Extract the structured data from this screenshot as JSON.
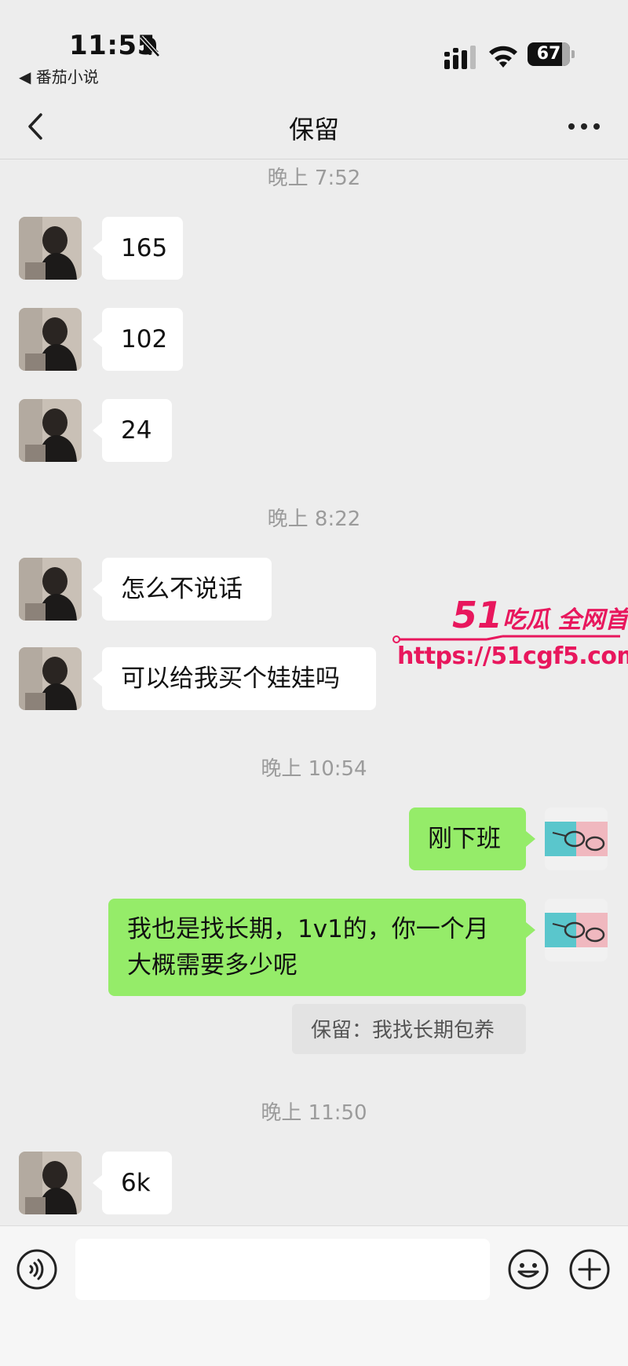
{
  "status_bar": {
    "time": "11:55",
    "back_app": "◀ 番茄小说",
    "battery": "67"
  },
  "nav": {
    "title": "保留"
  },
  "timestamps": {
    "t1": "晚上 7:52",
    "t2": "晚上 8:22",
    "t3": "晚上 10:54",
    "t4": "晚上 11:50"
  },
  "messages": {
    "m1": "165",
    "m2": "102",
    "m3": "24",
    "m4": "怎么不说话",
    "m5": "可以给我买个娃娃吗",
    "m6": "刚下班",
    "m7": "我也是找长期，1v1的，你一个月大概需要多少呢",
    "m7_quote": "保留：我找长期包养",
    "m8": "6k"
  },
  "watermark": {
    "brand_num": "51",
    "brand_text": "吃瓜 全网首发",
    "url": "https://51cgf5.com"
  },
  "input": {
    "placeholder": ""
  },
  "colors": {
    "background": "#ededed",
    "bubble_out": "#95ec69",
    "bubble_in": "#ffffff",
    "watermark": "#e8175d"
  },
  "icons": [
    "bell-muted-icon",
    "signal-icon",
    "wifi-icon",
    "battery-icon",
    "back-chevron-icon",
    "more-icon",
    "voice-icon",
    "emoji-icon",
    "plus-icon"
  ]
}
